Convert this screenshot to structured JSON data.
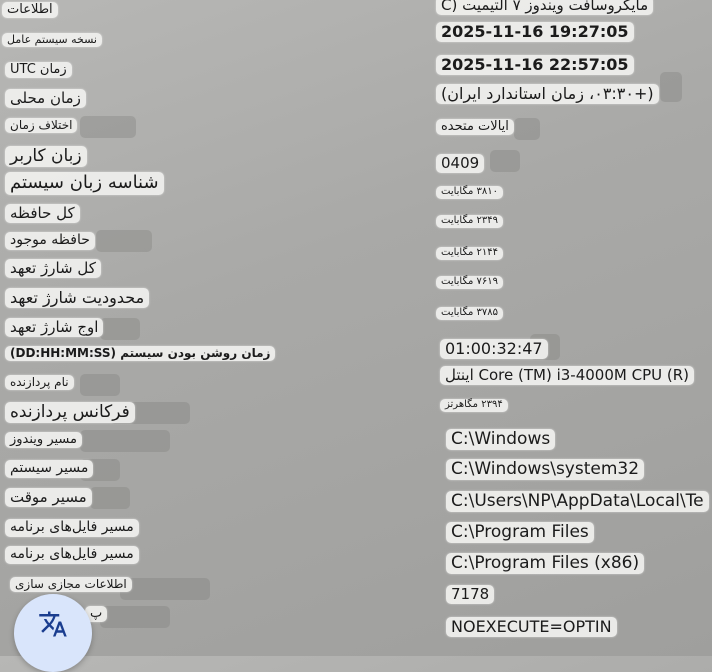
{
  "labels": {
    "l0": "اطلاعات",
    "l1": "نسخه سیستم عامل",
    "l2": "زمان UTC",
    "l3": "زمان محلی",
    "l4": "اختلاف زمان",
    "l5": "زبان کاربر",
    "l6": "شناسه زبان سیستم",
    "l7": "کل حافظه",
    "l8": "حافظه موجود",
    "l9": "کل شارژ تعهد",
    "l10": "محدودیت شارژ تعهد",
    "l11": "اوج شارژ تعهد",
    "l12": "زمان روشن بودن سیستم (DD:HH:MM:SS)",
    "l13": "نام پردازنده",
    "l14": "فرکانس پردازنده",
    "l15": "مسیر ویندوز",
    "l16": "مسیر سیستم",
    "l17": "مسیر موقت",
    "l18": "مسیر فایل‌های برنامه",
    "l19": "مسیر فایل‌های برنامه",
    "l20": "اطلاعات مجازی سازی",
    "l21": "پ"
  },
  "values": {
    "v0": "مایکروسافت ویندوز ۷ التیمیت (C",
    "v1": "2025-11-16 19:27:05",
    "v2": "2025-11-16 22:57:05",
    "v3": "(+۰۳:۳۰، زمان استاندارد ایران)",
    "v4": "ایالات متحده",
    "v5": "0409",
    "v6": "۳۸۱۰ مگابایت",
    "v7": "۲۳۴۹ مگابایت",
    "v8": "۲۱۴۴ مگابایت",
    "v9": "۷۶۱۹ مگابایت",
    "v10": "۳۷۸۵ مگابایت",
    "v11": "01:00:32:47",
    "v12": "Core (TM) i3-4000M CPU (R) اینتل",
    "v13": "۲۳۹۴ مگاهرتز",
    "v14": "C:\\Windows",
    "v15": "C:\\Windows\\system32",
    "v16": "C:\\Users\\NP\\AppData\\Local\\Te",
    "v17": "C:\\Program Files",
    "v18": "C:\\Program Files (x86)",
    "v19": "7178",
    "v20": "NOEXECUTE=OPTIN"
  },
  "fab": {
    "icon": "translate-icon",
    "color": "#d9e5fb"
  }
}
